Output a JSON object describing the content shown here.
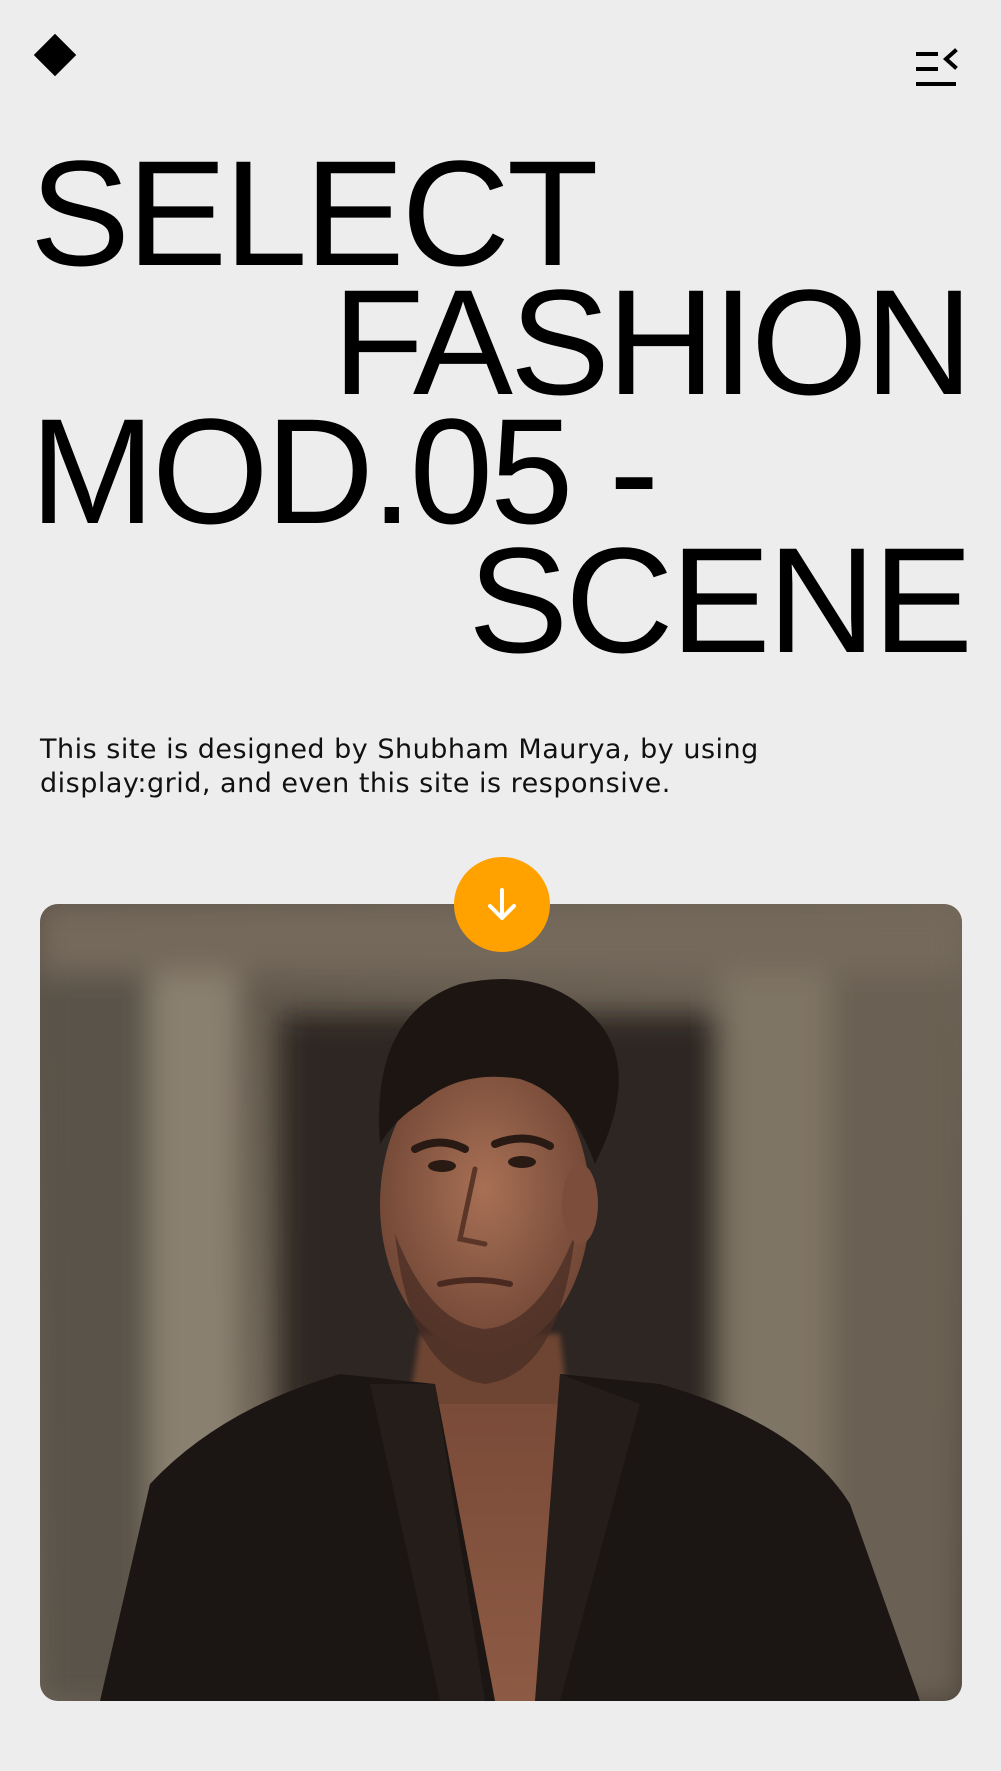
{
  "header": {
    "logo_icon": "diamond-icon",
    "menu_icon": "menu-collapse-icon"
  },
  "hero": {
    "lines": [
      "SELECT",
      "FASHION",
      "MOD.05 -",
      "SCENE"
    ]
  },
  "intro": {
    "text": "This site is designed by Shubham Maurya, by using display:grid, and even this site is responsive."
  },
  "scroll_button": {
    "icon": "arrow-down-icon",
    "color": "#ffa200"
  },
  "media": {
    "subject": "fashion-model-photo"
  },
  "colors": {
    "background": "#ededed",
    "text": "#000000",
    "accent": "#ffa200"
  }
}
